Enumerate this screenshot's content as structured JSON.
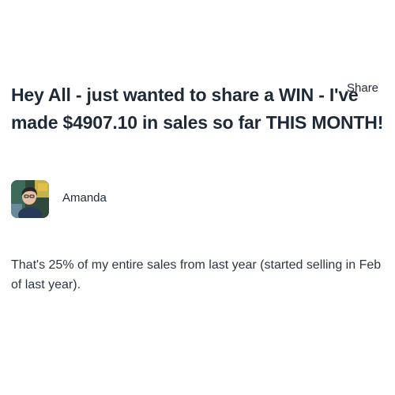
{
  "post": {
    "title": "Hey All - just wanted to share a WIN - I've made $4907.10 in sales so far THIS MONTH!",
    "share_label": "Share",
    "author": {
      "name": "Amanda",
      "avatar_icon": "user-avatar-photo"
    },
    "body": "That's 25% of my entire sales from last year (started selling in Feb of last year)."
  }
}
